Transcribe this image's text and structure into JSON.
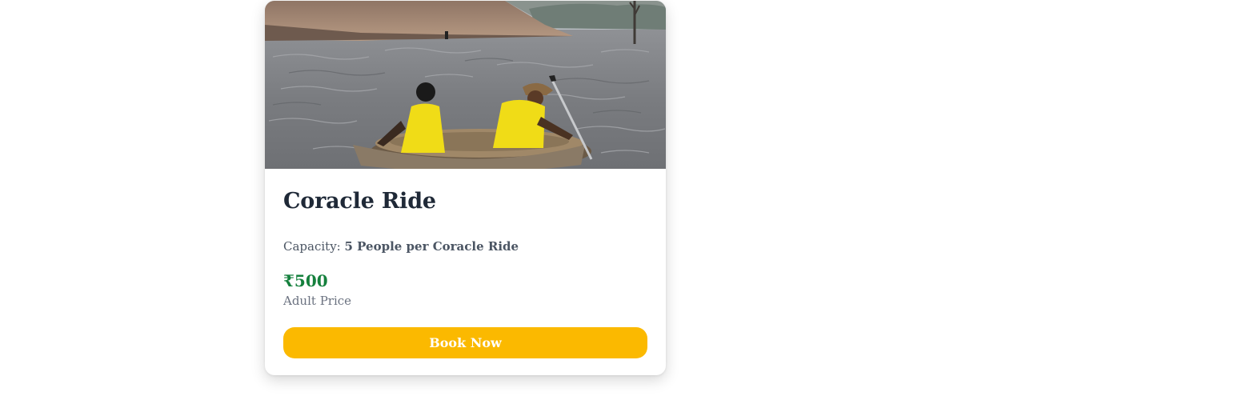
{
  "card": {
    "image_alt": "Two people in yellow life jackets paddling a coracle on a lake",
    "title": "Coracle Ride",
    "capacity_label": "Capacity: ",
    "capacity_value": "5 People per Coracle Ride",
    "price": "₹500",
    "price_label": "Adult Price",
    "button_label": "Book Now"
  },
  "colors": {
    "button": "#fbb900",
    "price": "#15803d",
    "title": "#1f2937"
  }
}
